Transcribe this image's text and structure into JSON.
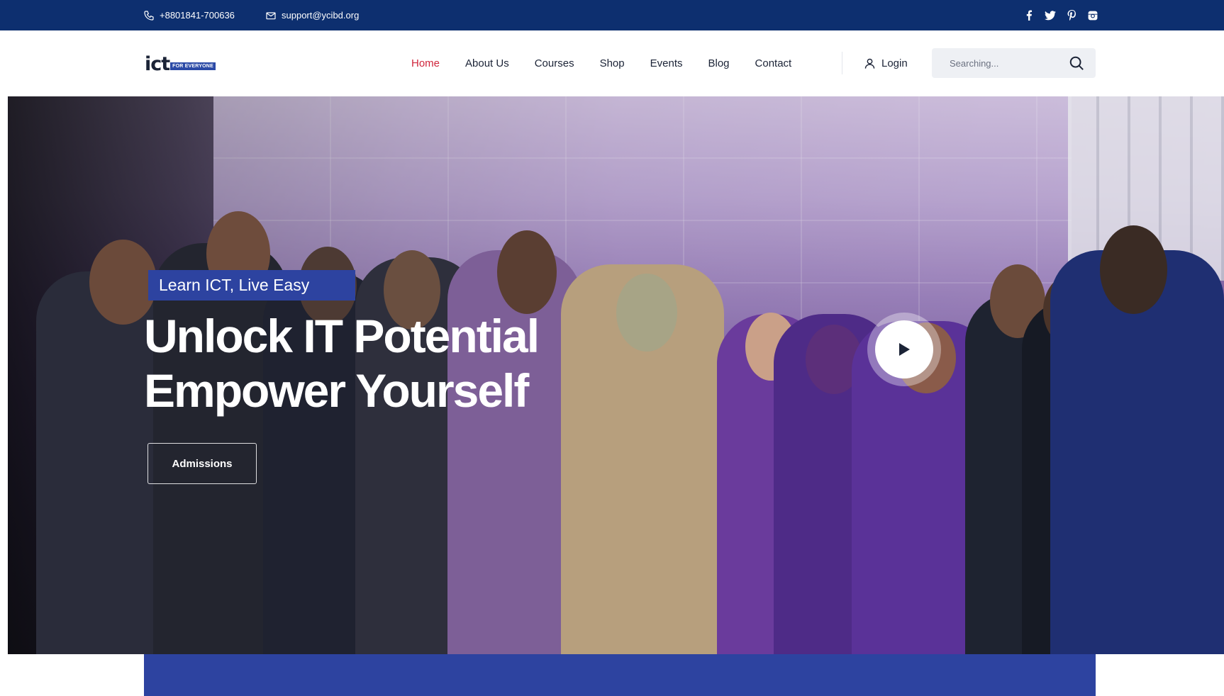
{
  "topbar": {
    "phone": "+8801841-700636",
    "email": "support@ycibd.org",
    "phone_icon": "phone-icon",
    "email_icon": "envelope-icon",
    "social": [
      "facebook-icon",
      "twitter-icon",
      "pinterest-icon",
      "instagram-icon"
    ]
  },
  "header": {
    "logo_text": "ict",
    "logo_tag": "FOR EVERYONE",
    "nav": [
      "Home",
      "About Us",
      "Courses",
      "Shop",
      "Events",
      "Blog",
      "Contact"
    ],
    "active_nav": "Home",
    "login_label": "Login",
    "search_placeholder": "Searching..."
  },
  "hero": {
    "tagline": "Learn ICT, Live Easy",
    "headline_line1": "Unlock IT Potential",
    "headline_line2": "Empower Yourself",
    "cta_label": "Admissions"
  },
  "colors": {
    "topbar_bg": "#0d2f6f",
    "accent_blue": "#2d43a0",
    "active_nav": "#d0263c"
  }
}
